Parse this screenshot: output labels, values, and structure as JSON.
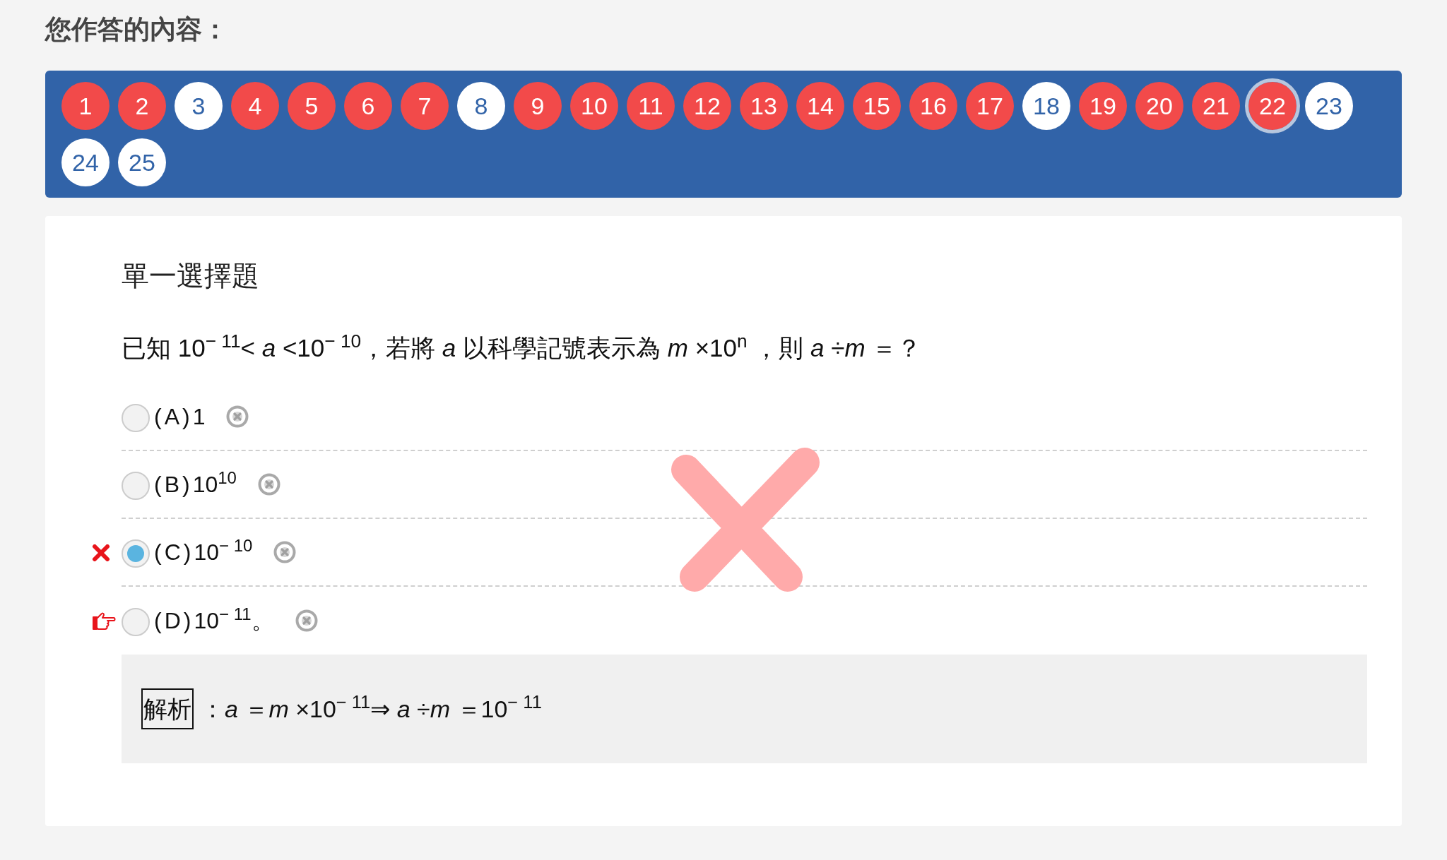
{
  "heading": "您作答的內容：",
  "question_nav": [
    {
      "label": "1",
      "correct": false,
      "selected": false
    },
    {
      "label": "2",
      "correct": false,
      "selected": false
    },
    {
      "label": "3",
      "correct": true,
      "selected": false
    },
    {
      "label": "4",
      "correct": false,
      "selected": false
    },
    {
      "label": "5",
      "correct": false,
      "selected": false
    },
    {
      "label": "6",
      "correct": false,
      "selected": false
    },
    {
      "label": "7",
      "correct": false,
      "selected": false
    },
    {
      "label": "8",
      "correct": true,
      "selected": false
    },
    {
      "label": "9",
      "correct": false,
      "selected": false
    },
    {
      "label": "10",
      "correct": false,
      "selected": false
    },
    {
      "label": "11",
      "correct": false,
      "selected": false
    },
    {
      "label": "12",
      "correct": false,
      "selected": false
    },
    {
      "label": "13",
      "correct": false,
      "selected": false
    },
    {
      "label": "14",
      "correct": false,
      "selected": false
    },
    {
      "label": "15",
      "correct": false,
      "selected": false
    },
    {
      "label": "16",
      "correct": false,
      "selected": false
    },
    {
      "label": "17",
      "correct": false,
      "selected": false
    },
    {
      "label": "18",
      "correct": true,
      "selected": false
    },
    {
      "label": "19",
      "correct": false,
      "selected": false
    },
    {
      "label": "20",
      "correct": false,
      "selected": false
    },
    {
      "label": "21",
      "correct": false,
      "selected": false
    },
    {
      "label": "22",
      "correct": false,
      "selected": true
    },
    {
      "label": "23",
      "correct": true,
      "selected": false
    },
    {
      "label": "24",
      "correct": true,
      "selected": false
    },
    {
      "label": "25",
      "correct": true,
      "selected": false
    }
  ],
  "question": {
    "type_label": "單一選擇題",
    "text": "已知 10$^{− 11}$< *a* <10$^{− 10}$，若將 *a* 以科學記號表示為 *m* ×10$^{n}$ ，則 *a* ÷*m* ＝？",
    "correct": false,
    "options": [
      {
        "kind": "plain",
        "label": "(A)",
        "text": "1",
        "selected": false
      },
      {
        "kind": "plain",
        "label": "(B)",
        "text": "10$^{10}$",
        "selected": false
      },
      {
        "kind": "wrong",
        "label": "(C)",
        "text": "10$^{− 10}$",
        "selected": true
      },
      {
        "kind": "answer",
        "label": "(D)",
        "text": "10$^{− 11}$。",
        "selected": false
      }
    ],
    "analysis": {
      "label": "解析",
      "text": "：*a* ＝*m* ×10$^{− 11}$⇒ *a* ÷*m* ＝10$^{− 11}$"
    }
  }
}
